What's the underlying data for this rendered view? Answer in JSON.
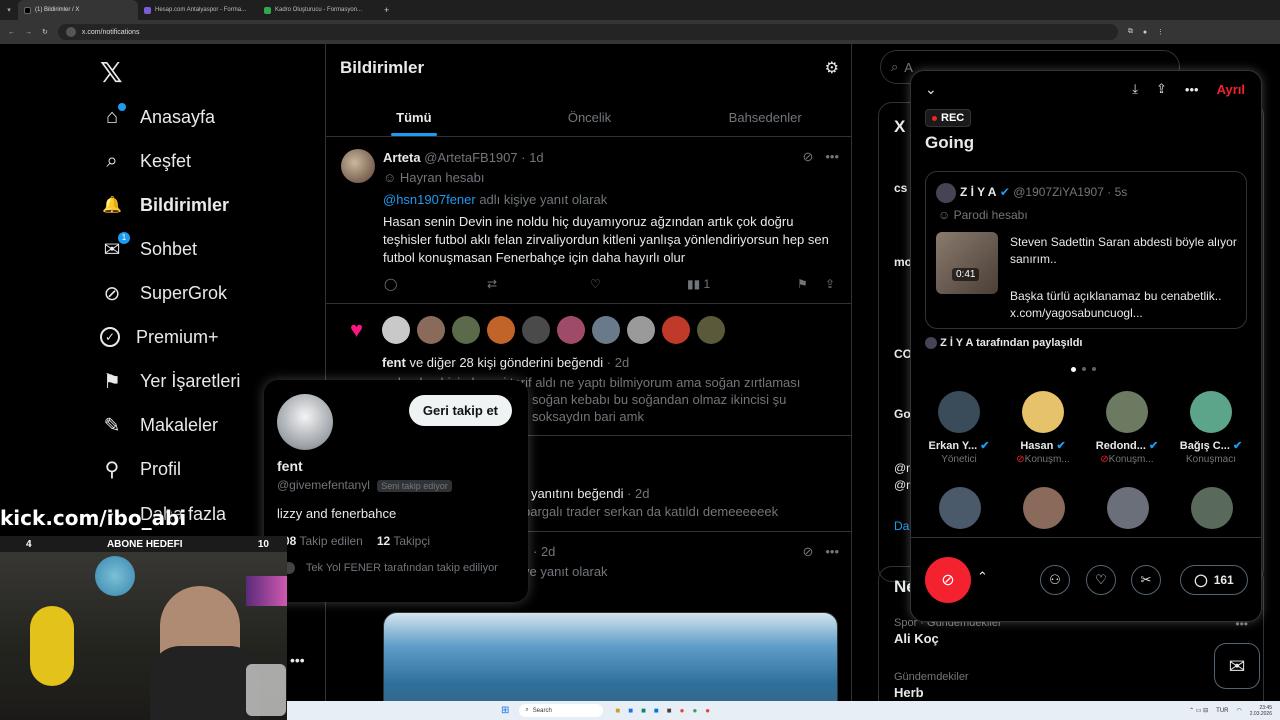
{
  "browser": {
    "tabs": [
      "(1) Bildirimler / X",
      "Hesap.com Antalyaspor - Forma...",
      "Kadro Oluşturucu - Formasyon..."
    ],
    "url": "x.com/notifications",
    "new_tab": "+"
  },
  "nav": {
    "logo": "𝕏",
    "items": [
      {
        "label": "Anasayfa",
        "icon": "⌂"
      },
      {
        "label": "Keşfet",
        "icon": "⌕"
      },
      {
        "label": "Bildirimler",
        "icon": "🔔"
      },
      {
        "label": "Sohbet",
        "icon": "✉"
      },
      {
        "label": "SuperGrok",
        "icon": "⊘"
      },
      {
        "label": "Premium+",
        "icon": "✓"
      },
      {
        "label": "Yer İşaretleri",
        "icon": "⚑"
      },
      {
        "label": "Makaleler",
        "icon": "✎"
      },
      {
        "label": "Profil",
        "icon": "⚲"
      },
      {
        "label": "Daha fazla",
        "icon": "⋯"
      }
    ],
    "chat_badge": "1"
  },
  "center": {
    "title": "Bildirimler",
    "tabs": [
      "Tümü",
      "Öncelik",
      "Bahsedenler"
    ],
    "post1": {
      "name": "Arteta",
      "handle": "@ArtetaFB1907",
      "time": "· 1d",
      "label": "Hayran hesabı",
      "reply_link": "@hsn1907fener",
      "reply_text": " adlı kişiye yanıt olarak",
      "body": "Hasan senin Devin ine noldu hiç duyamıyoruz ağzından artık çok doğru teşhisler futbol aklı felan zirvaliyordun kitleni yanlışa yönlendiriyorsun hep sen futbol konuşmasan Fenerbahçe için daha hayırlı olur",
      "views": "1"
    },
    "like": {
      "who": "fent",
      "rest": " ve diğer 28 kişi gönderini beğendi",
      "time": " · 2d",
      "body1": "redenda ehisinden mi tarif aldı ne yaptı bilmiyorum ama soğan zırtlaması",
      "body2": "soğan kebabı bu soğandan olmaz  ikincisi şu",
      "body3": "soksaydın bari amk"
    },
    "reply_like": {
      "text": "r yanıtını beğendi",
      "time": " · 2d",
      "body": "pargalı trader serkan da katıldı demeeeeeek"
    },
    "post3": {
      "time": "· 2d",
      "reply": "ye yanıt olarak"
    }
  },
  "hovercard": {
    "follow_back": "Geri takip et",
    "name": "fent",
    "handle": "@givemefentanyl",
    "follows_you": "Seni takip ediyor",
    "bio": "lizzy and fenerbahce",
    "following_count": "08",
    "following_label": "Takip edilen",
    "followers_count": "12",
    "followers_label": "Takipçi",
    "followed_by": "Tek Yol FENER tarafından takip ediliyor"
  },
  "space": {
    "leave": "Ayrıl",
    "rec": "REC",
    "title": "Going",
    "tweet": {
      "name": "Z İ Y A",
      "handle": "@1907ZiYA1907",
      "time": "· 5s",
      "label": "Parodi hesabı",
      "duration": "0:41",
      "text1": "Steven Sadettin Saran abdesti böyle alıyor sanırım..",
      "text2": "Başka türlü açıklanamaz bu cenabetlik.. x.com/yagosabuncuogl..."
    },
    "shared_by": "Z İ Y A tarafından paylaşıldı",
    "speakers": [
      {
        "name": "Erkan Y...",
        "role": "Yönetici",
        "color": "#3a4c5a"
      },
      {
        "name": "Hasan",
        "role": "Konuşm...",
        "color": "#e6c36a"
      },
      {
        "name": "Redond...",
        "role": "Konuşm...",
        "color": "#6b7a60"
      },
      {
        "name": "Bağış C...",
        "role": "Konuşmacı",
        "color": "#5ca58a"
      }
    ],
    "comment_count": "161"
  },
  "right": {
    "search_placeholder": "A",
    "trend1_cat": "Spor · Gündemdekiler",
    "trend1_name": "Ali Koç",
    "trend2_cat": "Gündemdekiler",
    "trend2_name": "Herb",
    "partial": [
      "X",
      "cs",
      "mo",
      "CO",
      "Go",
      "@n",
      "@n",
      "Da",
      "Ne"
    ]
  },
  "stream": {
    "kick": "kick.com/ibo_abi",
    "goal_left": "4",
    "goal_label": "ABONE HEDEFI",
    "goal_right": "10"
  },
  "taskbar": {
    "search": "Search",
    "lang": "TUR",
    "time": "23:45",
    "date": "2.03.2026"
  },
  "colors": {
    "accent": "#1d9bf0",
    "like": "#f91880",
    "leave": "#f4212e"
  }
}
